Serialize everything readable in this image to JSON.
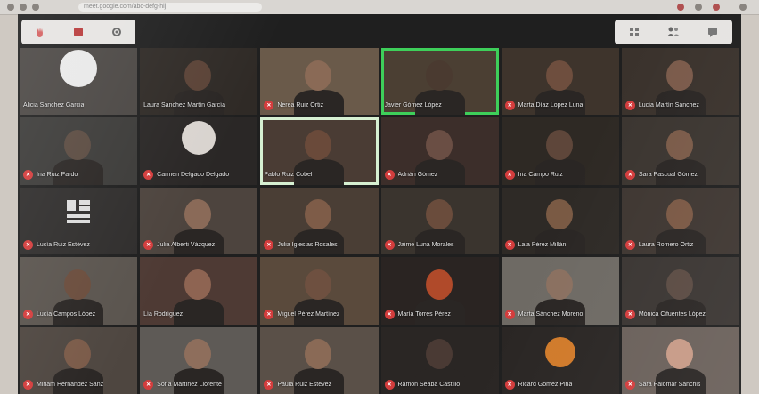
{
  "browser": {
    "url": "meet.google.com/abc-defg-hij"
  },
  "toolbar": {
    "left_icons": [
      "hand-icon",
      "record-icon",
      "settings-icon"
    ],
    "right_icons": [
      "grid-view-icon",
      "people-icon",
      "chat-icon"
    ]
  },
  "participants": [
    {
      "name": "Alicia Sanchez Garcia",
      "muted": false,
      "bg": "#4a4643",
      "skin": "#e9e9e9",
      "style": "avatar"
    },
    {
      "name": "Laura Sánchez Martín García",
      "muted": false,
      "bg": "#2f2a26",
      "skin": "#5a4236",
      "style": "person"
    },
    {
      "name": "Nerea Ruiz Ortiz",
      "muted": true,
      "bg": "#6a5a4a",
      "skin": "#8a6a56",
      "style": "person"
    },
    {
      "name": "Javier Gómez López",
      "muted": false,
      "bg": "#4b3f33",
      "skin": "#4a3a30",
      "style": "person",
      "speaking": true
    },
    {
      "name": "Marta Díaz Lopez Luna",
      "muted": true,
      "bg": "#3e342c",
      "skin": "#6e4e3e",
      "style": "person"
    },
    {
      "name": "Lucía Martín Sánchez",
      "muted": true,
      "bg": "#3a322c",
      "skin": "#7a5a4a",
      "style": "person"
    },
    {
      "name": "Iria Ruiz Pardo",
      "muted": true,
      "bg": "#3b3a38",
      "skin": "#5a4a40",
      "style": "person"
    },
    {
      "name": "Carmen Delgado Delgado",
      "muted": true,
      "bg": "#2a2726",
      "skin": "#d9d4cf",
      "style": "logo"
    },
    {
      "name": "Pablo Ruiz Cobel",
      "muted": false,
      "bg": "#4a3c34",
      "skin": "#6a4a3a",
      "style": "person",
      "selected": true
    },
    {
      "name": "Adrián Gómez",
      "muted": true,
      "bg": "#3c2e2a",
      "skin": "#6a4e44",
      "style": "person"
    },
    {
      "name": "Iria Campo Ruiz",
      "muted": true,
      "bg": "#2e2924",
      "skin": "#5e463a",
      "style": "person"
    },
    {
      "name": "Sara Pascual Gómez",
      "muted": true,
      "bg": "#3b3530",
      "skin": "#7a5a48",
      "style": "person"
    },
    {
      "name": "Lucía Ruiz Estévez",
      "muted": true,
      "bg": "#2f2d2c",
      "skin": "#d8d8d8",
      "style": "cards"
    },
    {
      "name": "Julia Alberti Vázquez",
      "muted": true,
      "bg": "#4d443e",
      "skin": "#8a6a58",
      "style": "person"
    },
    {
      "name": "Julia Iglesias Rosales",
      "muted": true,
      "bg": "#4a3e35",
      "skin": "#7e5c48",
      "style": "person"
    },
    {
      "name": "Jaime Luna Morales",
      "muted": true,
      "bg": "#3a342e",
      "skin": "#6a4c3c",
      "style": "person"
    },
    {
      "name": "Laia Pérez Millán",
      "muted": true,
      "bg": "#2e2a26",
      "skin": "#7a5a44",
      "style": "person"
    },
    {
      "name": "Laura Romero Ortiz",
      "muted": true,
      "bg": "#3e3631",
      "skin": "#7a5844",
      "style": "person"
    },
    {
      "name": "Lucía Campos López",
      "muted": true,
      "bg": "#5a544e",
      "skin": "#6a4c3c",
      "style": "person"
    },
    {
      "name": "Lía Rodríguez",
      "muted": false,
      "bg": "#4e3a34",
      "skin": "#8e6452",
      "style": "person"
    },
    {
      "name": "Miguel Pérez Martínez",
      "muted": true,
      "bg": "#5a4a3c",
      "skin": "#6e5040",
      "style": "person"
    },
    {
      "name": "María Torres Pérez",
      "muted": true,
      "bg": "#2a2422",
      "skin": "#b04a2a",
      "style": "person"
    },
    {
      "name": "Marta Sánchez Moreno",
      "muted": true,
      "bg": "#6e6a64",
      "skin": "#8a7060",
      "style": "person"
    },
    {
      "name": "Mónica Cifuentes López",
      "muted": true,
      "bg": "#3a3532",
      "skin": "#5a4a42",
      "style": "person"
    },
    {
      "name": "Miriam Hernández Sanz",
      "muted": true,
      "bg": "#4e4640",
      "skin": "#7a5a48",
      "style": "person"
    },
    {
      "name": "Sofía Martínez Llorente",
      "muted": true,
      "bg": "#5e5a56",
      "skin": "#8e6e5c",
      "style": "person"
    },
    {
      "name": "Paula Ruiz Estévez",
      "muted": true,
      "bg": "#5a5048",
      "skin": "#8a6a56",
      "style": "person"
    },
    {
      "name": "Ramón Seaba Castillo",
      "muted": true,
      "bg": "#2a2624",
      "skin": "#4a3a34",
      "style": "dark"
    },
    {
      "name": "Ricard Gómez Pina",
      "muted": true,
      "bg": "#2a2624",
      "skin": "#d07a2a",
      "style": "badge"
    },
    {
      "name": "Sara Palomar Sanchis",
      "muted": true,
      "bg": "#6a605a",
      "skin": "#c79a86",
      "style": "person"
    }
  ]
}
